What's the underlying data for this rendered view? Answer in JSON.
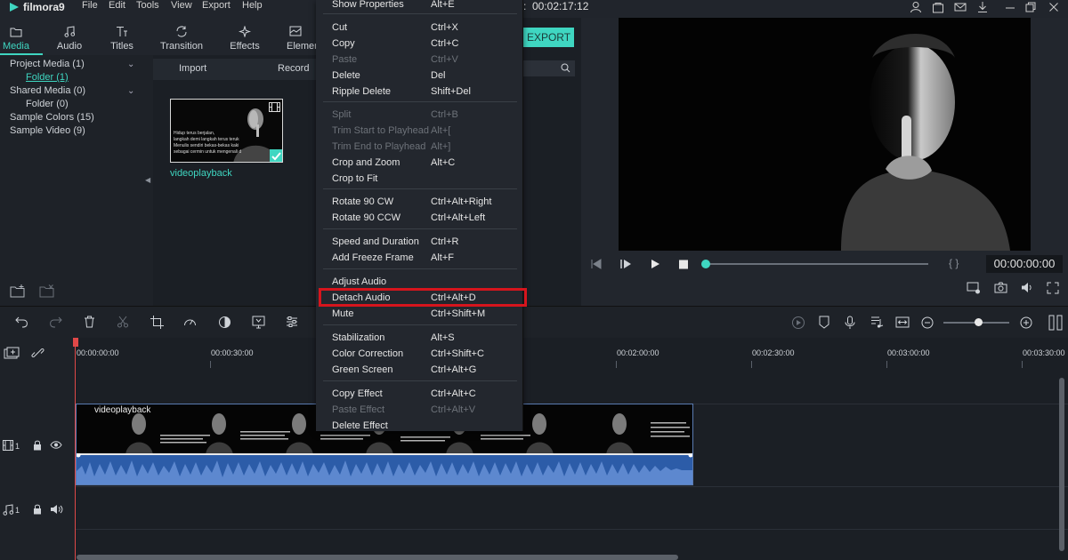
{
  "app": {
    "logo": "filmora9",
    "menu": [
      "File",
      "Edit",
      "Tools",
      "View",
      "Export",
      "Help"
    ],
    "timecode": "00:02:17:12"
  },
  "tabs": [
    {
      "label": "Media",
      "icon": "folder-icon"
    },
    {
      "label": "Audio",
      "icon": "music-note-icon"
    },
    {
      "label": "Titles",
      "icon": "text-icon"
    },
    {
      "label": "Transition",
      "icon": "transition-icon"
    },
    {
      "label": "Effects",
      "icon": "sparkle-icon"
    },
    {
      "label": "Elemen",
      "icon": "elements-icon"
    }
  ],
  "tree": [
    {
      "label": "Project Media (1)"
    },
    {
      "label": "Folder (1)"
    },
    {
      "label": "Shared Media (0)"
    },
    {
      "label": "Folder (0)"
    },
    {
      "label": "Sample Colors (15)"
    },
    {
      "label": "Sample Video (9)"
    }
  ],
  "media": {
    "import_label": "Import",
    "record_label": "Record",
    "clip_name": "videoplayback",
    "thumb_text": [
      "Hidup terus berjalan,",
      "langkah demi langkah terus teruk",
      "Menulis sendiri bekas-bekas kaki",
      "sebagai cermin untuk mengenali d"
    ]
  },
  "context_menu": {
    "groups": [
      [
        {
          "label": "Show Properties",
          "shortcut": "Alt+E",
          "enabled": true
        }
      ],
      [
        {
          "label": "Cut",
          "shortcut": "Ctrl+X",
          "enabled": true
        },
        {
          "label": "Copy",
          "shortcut": "Ctrl+C",
          "enabled": true
        },
        {
          "label": "Paste",
          "shortcut": "Ctrl+V",
          "enabled": false
        },
        {
          "label": "Delete",
          "shortcut": "Del",
          "enabled": true
        },
        {
          "label": "Ripple Delete",
          "shortcut": "Shift+Del",
          "enabled": true
        }
      ],
      [
        {
          "label": "Split",
          "shortcut": "Ctrl+B",
          "enabled": false
        },
        {
          "label": "Trim Start to Playhead",
          "shortcut": "Alt+[",
          "enabled": false
        },
        {
          "label": "Trim End to Playhead",
          "shortcut": "Alt+]",
          "enabled": false
        },
        {
          "label": "Crop and Zoom",
          "shortcut": "Alt+C",
          "enabled": true
        },
        {
          "label": "Crop to Fit",
          "shortcut": "",
          "enabled": true
        }
      ],
      [
        {
          "label": "Rotate 90 CW",
          "shortcut": "Ctrl+Alt+Right",
          "enabled": true
        },
        {
          "label": "Rotate 90 CCW",
          "shortcut": "Ctrl+Alt+Left",
          "enabled": true
        }
      ],
      [
        {
          "label": "Speed and Duration",
          "shortcut": "Ctrl+R",
          "enabled": true
        },
        {
          "label": "Add Freeze Frame",
          "shortcut": "Alt+F",
          "enabled": true
        }
      ],
      [
        {
          "label": "Adjust Audio",
          "shortcut": "",
          "enabled": true
        },
        {
          "label": "Detach Audio",
          "shortcut": "Ctrl+Alt+D",
          "enabled": true
        },
        {
          "label": "Mute",
          "shortcut": "Ctrl+Shift+M",
          "enabled": true
        }
      ],
      [
        {
          "label": "Stabilization",
          "shortcut": "Alt+S",
          "enabled": true
        },
        {
          "label": "Color Correction",
          "shortcut": "Ctrl+Shift+C",
          "enabled": true
        },
        {
          "label": "Green Screen",
          "shortcut": "Ctrl+Alt+G",
          "enabled": true
        }
      ],
      [
        {
          "label": "Copy Effect",
          "shortcut": "Ctrl+Alt+C",
          "enabled": true
        },
        {
          "label": "Paste Effect",
          "shortcut": "Ctrl+Alt+V",
          "enabled": false
        },
        {
          "label": "Delete Effect",
          "shortcut": "",
          "enabled": true
        }
      ]
    ],
    "highlighted": "Detach Audio"
  },
  "export": {
    "label": "EXPORT"
  },
  "preview": {
    "timecode": "00:00:00:00",
    "braces": "{  }",
    "progress": 0
  },
  "timeline": {
    "ruler": [
      "00:00:00:00",
      "00:00:30:00",
      "00:02:00:00",
      "00:02:30:00",
      "00:03:00:00",
      "00:03:30:00"
    ],
    "video_track": "1",
    "audio_track": "1",
    "clip_title": "videoplayback"
  },
  "colors": {
    "accent": "#3fd6c1",
    "highlight": "#d6151d",
    "waveform": "#2c5ca8",
    "playhead": "#e04848"
  }
}
